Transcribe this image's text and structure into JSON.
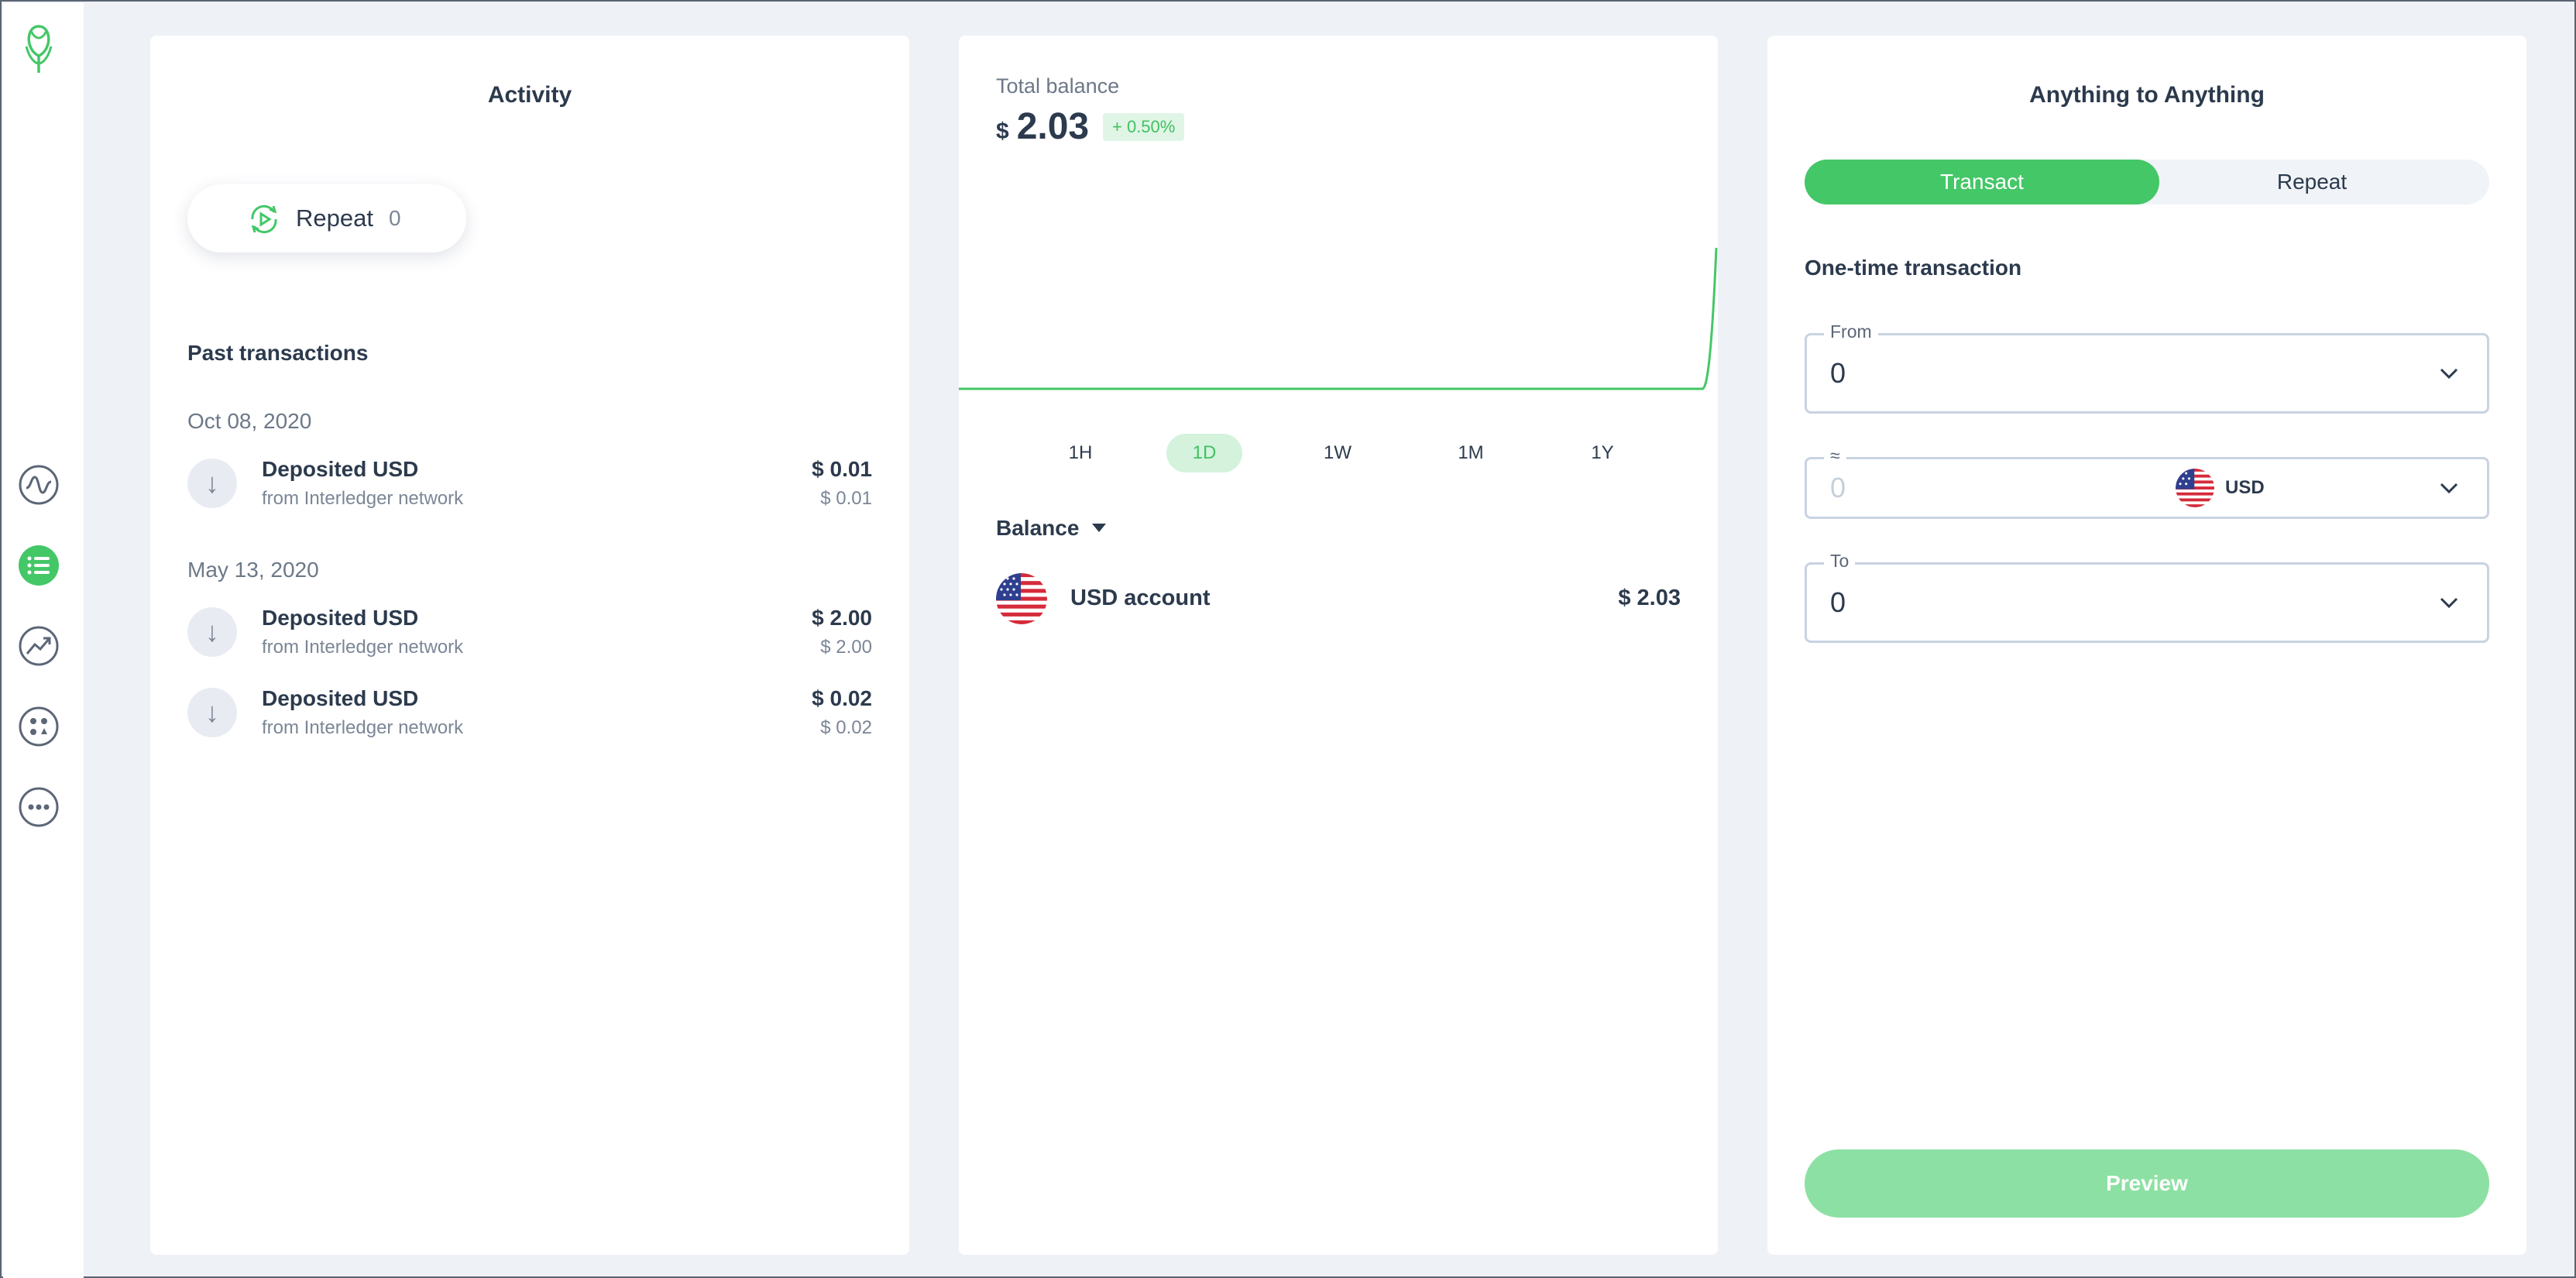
{
  "sidebar": {
    "logo": "uphold-logo-icon",
    "items": [
      {
        "name": "activity-pulse-icon"
      },
      {
        "name": "transactions-list-icon",
        "active": true
      },
      {
        "name": "markets-trend-icon"
      },
      {
        "name": "apps-grid-icon"
      },
      {
        "name": "more-icon"
      }
    ],
    "accent": "#44c767"
  },
  "activity": {
    "title": "Activity",
    "repeat_label": "Repeat",
    "repeat_count": "0",
    "past_title": "Past transactions",
    "groups": [
      {
        "date": "Oct 08, 2020",
        "transactions": [
          {
            "title": "Deposited USD",
            "subtitle": "from Interledger network",
            "amount": "$ 0.01",
            "amount_sub": "$ 0.01"
          }
        ]
      },
      {
        "date": "May 13, 2020",
        "transactions": [
          {
            "title": "Deposited USD",
            "subtitle": "from Interledger network",
            "amount": "$ 2.00",
            "amount_sub": "$ 2.00"
          },
          {
            "title": "Deposited USD",
            "subtitle": "from Interledger network",
            "amount": "$ 0.02",
            "amount_sub": "$ 0.02"
          }
        ]
      }
    ]
  },
  "balance": {
    "label": "Total balance",
    "currency_symbol": "$",
    "value": "2.03",
    "change": "+ 0.50%",
    "ranges": [
      "1H",
      "1D",
      "1W",
      "1M",
      "1Y"
    ],
    "active_range": "1D",
    "section_label": "Balance",
    "accounts": [
      {
        "name": "USD account",
        "value": "$ 2.03",
        "flag": "us-flag-icon"
      }
    ]
  },
  "chart_data": {
    "type": "line",
    "series": [
      {
        "values": [
          0,
          0,
          0,
          0,
          0,
          0,
          0,
          0,
          0,
          0,
          0,
          0,
          0,
          0,
          0,
          0,
          0,
          0,
          0,
          0,
          0,
          0,
          0,
          0,
          0,
          1
        ]
      }
    ],
    "color": "#44c767"
  },
  "transfer": {
    "title": "Anything to Anything",
    "tabs": [
      "Transact",
      "Repeat"
    ],
    "active_tab": "Transact",
    "subtitle": "One-time transaction",
    "from_label": "From",
    "from_value": "0",
    "approx_label": "≈",
    "approx_value": "0",
    "approx_currency": "USD",
    "to_label": "To",
    "to_value": "0",
    "preview_label": "Preview"
  }
}
